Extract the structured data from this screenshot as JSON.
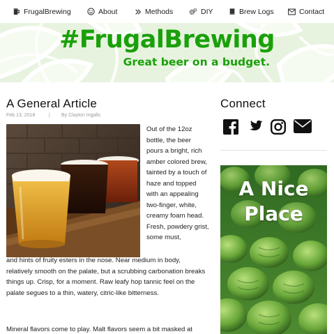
{
  "nav": {
    "items": [
      {
        "label": "FrugalBrewing",
        "icon": "beer-mug-icon"
      },
      {
        "label": "About",
        "icon": "smile-icon"
      },
      {
        "label": "Methods",
        "icon": "double-chevron-right-icon"
      },
      {
        "label": "DIY",
        "icon": "gears-icon"
      },
      {
        "label": "Brew Logs",
        "icon": "book-icon"
      },
      {
        "label": "Contact",
        "icon": "envelope-icon"
      }
    ]
  },
  "banner": {
    "title": "#FrugalBrewing",
    "tagline": "Great beer on a budget.",
    "colors": {
      "brand": "#1aa00a",
      "background": "#e7f3df"
    }
  },
  "article": {
    "title": "A General Article",
    "date": "Feb 13, 2018",
    "separator": "|",
    "author": "By Clayton Ingalls",
    "image": "beer-flight-photo",
    "text_narrow": "Out of the 12oz bottle, the beer pours a bright, rich amber colored brew, tainted by a touch of haze and topped with an appealing two-finger, white, creamy foam head. Fresh, powdery grist, some must,",
    "text_wide": "and hints of fruity esters in the nose. Near medium in body, relatively smooth on the palate, but a scrubbing carbonation breaks things up. Crisp, for a moment. Raw leafy hop tannic feel on the palate segues to a thin, watery, citric-like bitterness.",
    "text_para2": "Mineral flavors come to play. Malt flavors seem a bit masked at"
  },
  "sidebar": {
    "connect_title": "Connect",
    "social": [
      {
        "icon": "facebook-icon"
      },
      {
        "icon": "twitter-icon"
      },
      {
        "icon": "instagram-icon"
      },
      {
        "icon": "email-icon"
      }
    ],
    "ad": {
      "text": "A Nice Place",
      "line1": "A Nice",
      "line2": "Place",
      "image": "hops-photo"
    }
  }
}
